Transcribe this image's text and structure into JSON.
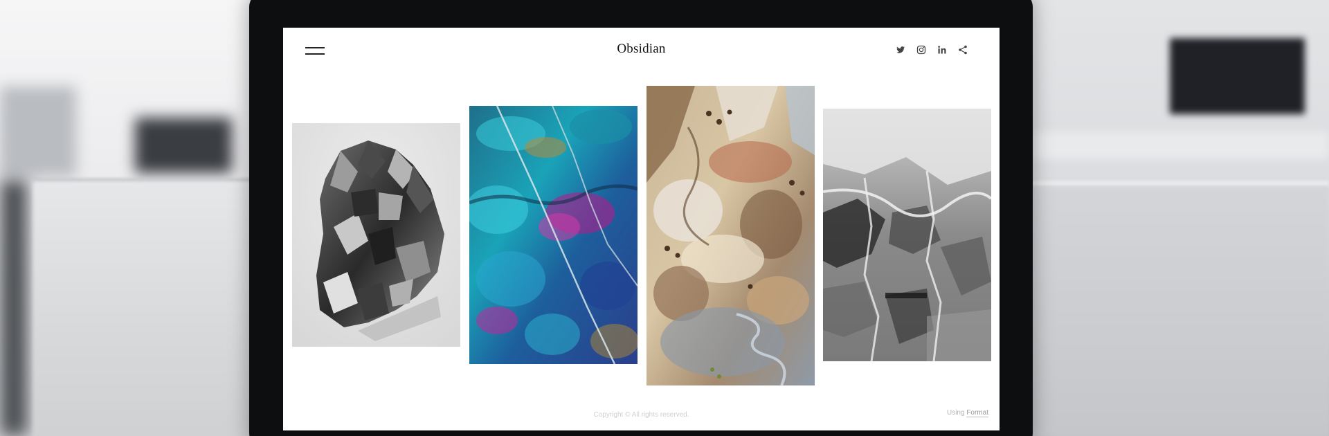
{
  "site": {
    "title": "Obsidian",
    "menu_icon": "hamburger-menu-icon",
    "social_icons": [
      "twitter-icon",
      "instagram-icon",
      "linkedin-icon",
      "share-icon"
    ]
  },
  "gallery": {
    "images": [
      {
        "name": "grey-crystal-cluster-image",
        "tone": "grayscale"
      },
      {
        "name": "iridescent-blue-mineral-image",
        "tone": "blue-teal-magenta"
      },
      {
        "name": "aerial-desert-terrain-image",
        "tone": "ochre-brown-blue"
      },
      {
        "name": "black-white-marble-image",
        "tone": "grayscale"
      }
    ]
  },
  "footer": {
    "copyright": "Copyright © All rights reserved.",
    "using_prefix": "Using",
    "using_link": "Format"
  },
  "colors": {
    "bezel": "#0d0e10",
    "screen_bg": "#ffffff",
    "title_text": "#111111"
  }
}
